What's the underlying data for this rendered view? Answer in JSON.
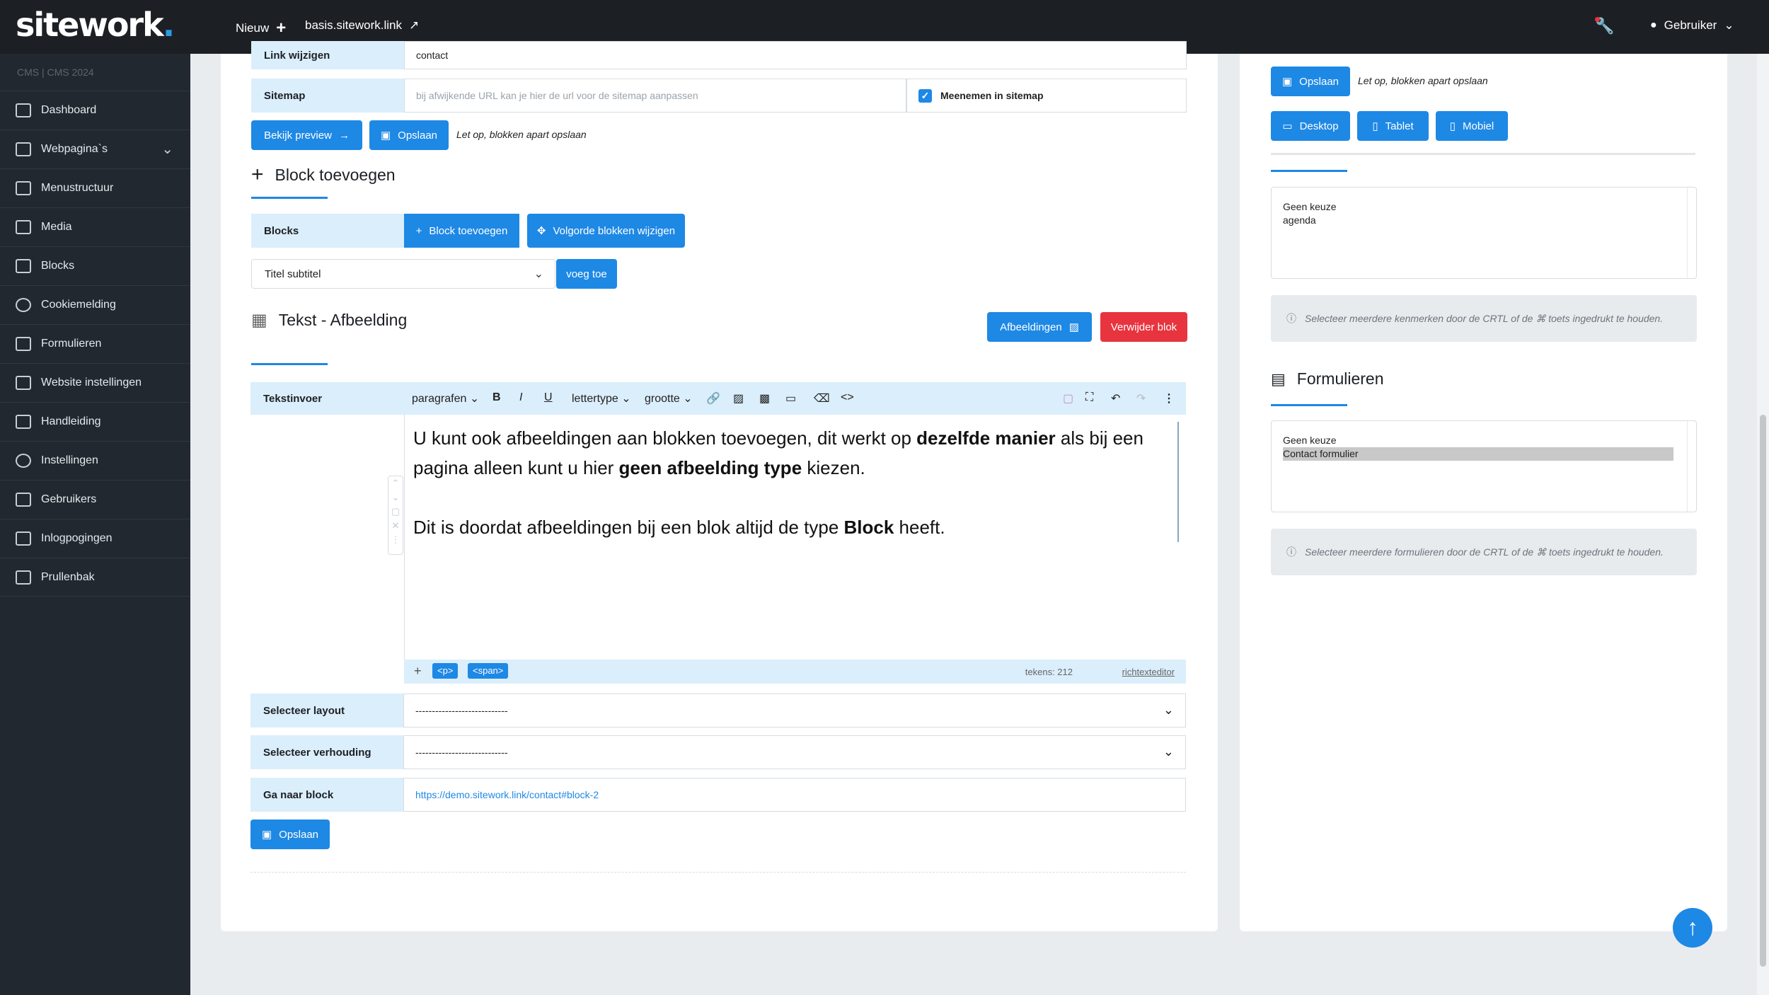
{
  "topbar": {
    "logo_text": "sitework",
    "logo_dot": ".",
    "new_label": "Nieuw",
    "site_link": "basis.sitework.link",
    "user_label": "Gebruiker"
  },
  "sidebar": {
    "version": "CMS | CMS 2024",
    "items": [
      {
        "label": "Dashboard"
      },
      {
        "label": "Webpagina`s"
      },
      {
        "label": "Menustructuur"
      },
      {
        "label": "Media"
      },
      {
        "label": "Blocks"
      },
      {
        "label": "Cookiemelding"
      },
      {
        "label": "Formulieren"
      },
      {
        "label": "Website instellingen"
      },
      {
        "label": "Handleiding"
      },
      {
        "label": "Instellingen"
      },
      {
        "label": "Gebruikers"
      },
      {
        "label": "Inlogpogingen"
      },
      {
        "label": "Prullenbak"
      }
    ]
  },
  "main": {
    "link_row": {
      "label": "Link wijzigen",
      "value": "contact"
    },
    "sitemap_row": {
      "label": "Sitemap",
      "placeholder": "bij afwijkende URL kan je hier de url voor de sitemap aanpassen",
      "checkbox_label": "Meenemen in sitemap"
    },
    "preview_button": "Bekijk preview",
    "save_button": "Opslaan",
    "save_note": "Let op, blokken apart opslaan",
    "block_section_title": "Block toevoegen",
    "blocks_row": {
      "label": "Blocks",
      "add_button": "Block toevoegen",
      "order_button": "Volgorde blokken wijzigen"
    },
    "block_select": "Titel subtitel",
    "add_button": "voeg toe",
    "block_title": "Tekst - Afbeelding",
    "images_button": "Afbeeldingen",
    "delete_button": "Verwijder blok",
    "editor": {
      "label": "Tekstinvoer",
      "toolbar": {
        "paragraphs": "paragrafen",
        "bold": "B",
        "italic": "I",
        "underline": "U",
        "font": "lettertype",
        "size": "grootte"
      },
      "para1_a": "U kunt ook afbeeldingen aan blokken toevoegen, dit werkt op ",
      "para1_b": "dezelfde manier",
      "para1_c": " als bij een pagina alleen kunt u hier ",
      "para1_d": "geen afbeelding type",
      "para1_e": " kiezen.",
      "para2_a": "Dit is doordat afbeeldingen bij een blok altijd de type ",
      "para2_b": "Block",
      "para2_c": " heeft.",
      "tag_p": "<p>",
      "tag_span": "<span>",
      "char_count": "tekens: 212",
      "editor_link": "richtexteditor"
    },
    "layout_row": {
      "label": "Selecteer layout",
      "value": "----------------------------"
    },
    "ratio_row": {
      "label": "Selecteer verhouding",
      "value": "----------------------------"
    },
    "goto_row": {
      "label": "Ga naar block",
      "value": "https://demo.sitework.link/contact#block-2"
    },
    "save_bottom": "Opslaan"
  },
  "side": {
    "save_button": "Opslaan",
    "save_note": "Let op, blokken apart opslaan",
    "desktop": "Desktop",
    "tablet": "Tablet",
    "mobile": "Mobiel",
    "kenmerken_options": [
      "Geen keuze",
      "agenda"
    ],
    "kenmerken_hint": "Selecteer meerdere kenmerken door de CRTL of de ⌘ toets ingedrukt te houden.",
    "forms_title": "Formulieren",
    "forms_options": [
      "Geen keuze",
      "Contact formulier"
    ],
    "forms_hint": "Selecteer meerdere formulieren door de CRTL of de ⌘ toets ingedrukt te houden."
  },
  "colors": {
    "accent": "#1e88e5",
    "danger": "#e8343f",
    "sidebar": "#212830",
    "topbar": "#1c2025"
  }
}
